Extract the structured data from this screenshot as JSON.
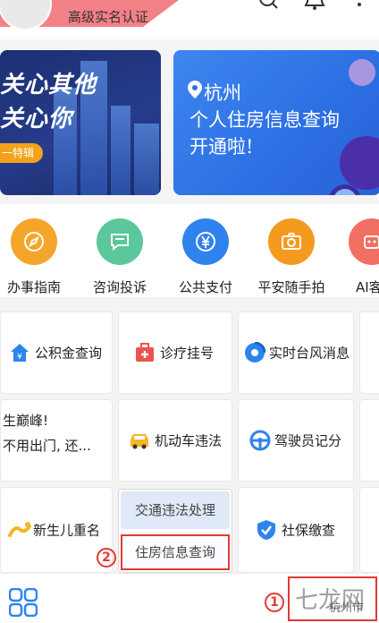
{
  "header": {
    "user_subtitle": "高级实名认证",
    "icons": [
      "search-icon",
      "bell-icon",
      "more-icon"
    ]
  },
  "banners": {
    "left": {
      "line1": "关心其他",
      "line2": "关心你",
      "tag": "一特辑"
    },
    "right": {
      "city": "杭州",
      "title": "个人住房信息查询",
      "subtitle": "开通啦!"
    }
  },
  "quick_actions": [
    {
      "label": "办事指南",
      "color": "#f4a62a",
      "icon": "compass-icon"
    },
    {
      "label": "咨询投诉",
      "color": "#5bc79a",
      "icon": "chat-icon"
    },
    {
      "label": "公共支付",
      "color": "#2f83ee",
      "icon": "yen-icon"
    },
    {
      "label": "平安随手拍",
      "color": "#f49a1f",
      "icon": "camera-icon"
    },
    {
      "label": "AI客",
      "color": "#f26f64",
      "icon": "ai-icon"
    }
  ],
  "services": {
    "gjj": "公积金查询",
    "clinic": "诊疗挂号",
    "typhoon": "实时台风消息",
    "ad_line1": "生巅峰!",
    "ad_line2": "不用出门, 还...",
    "vehicle": "机动车违法",
    "driver": "驾驶员记分",
    "newborn": "新生儿重名",
    "social": "社保缴查",
    "traffic": "交通违法处理",
    "housing": "住房信息查询"
  },
  "markers": {
    "m1": "1",
    "m2": "2"
  },
  "bottom": {
    "watermark": "七龙网",
    "city": "杭州市"
  },
  "colors": {
    "accent": "#2f83ee",
    "highlight": "#e03a33"
  }
}
